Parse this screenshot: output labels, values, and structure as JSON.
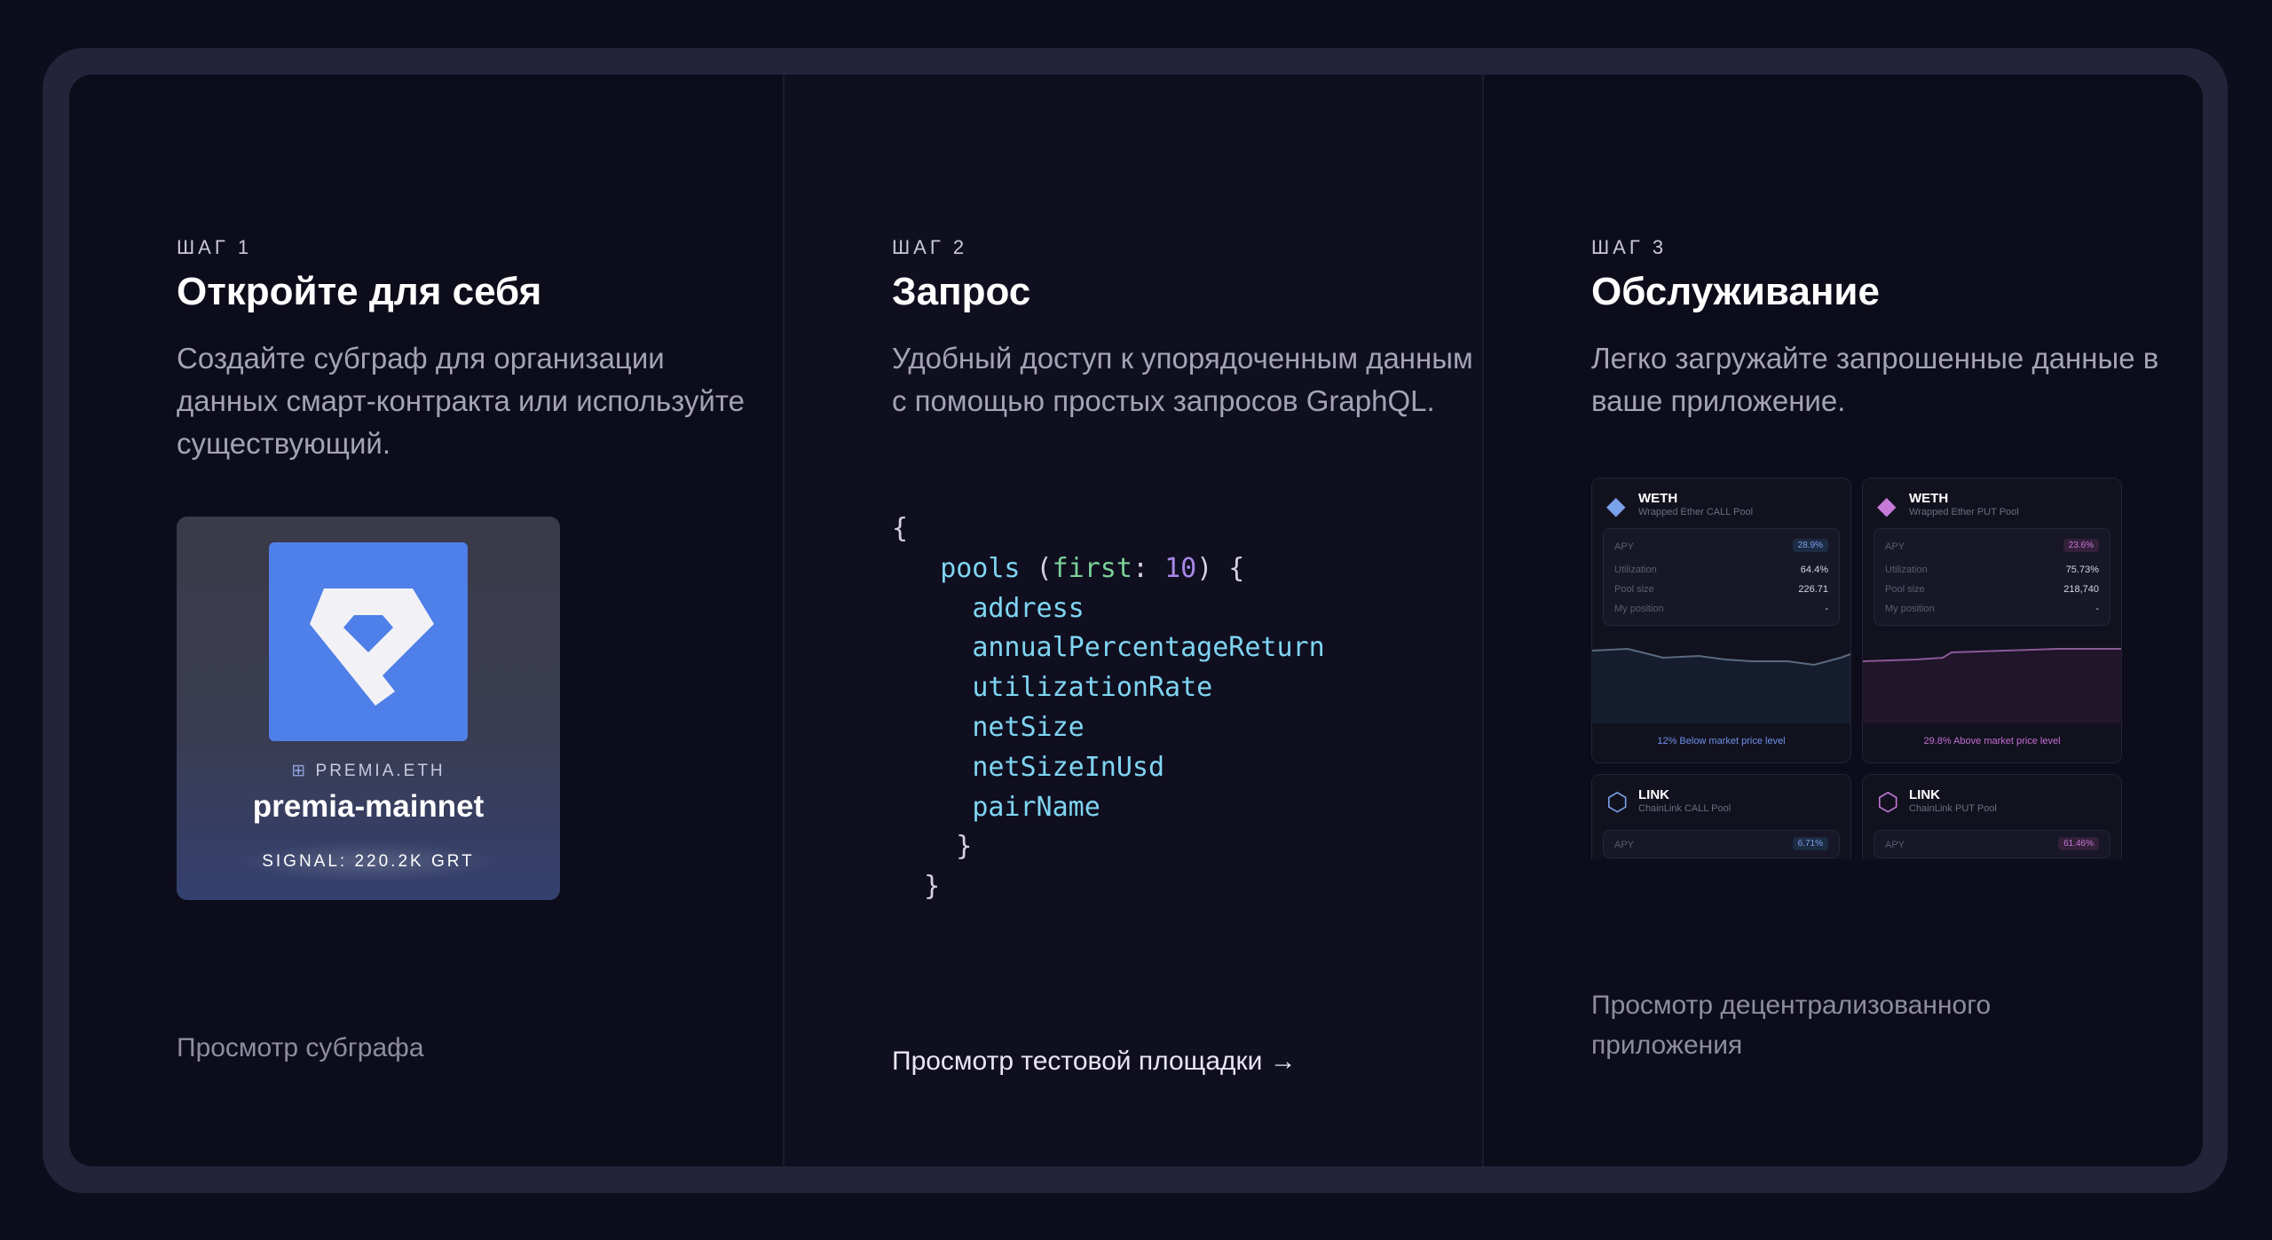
{
  "steps": [
    {
      "step": "ШАГ 1",
      "title": "Откройте для себя",
      "description": "Создайте субграф для организации данных смарт-контракта или используйте существующий.",
      "card": {
        "org": "PREMIA.ETH",
        "name": "premia-mainnet",
        "signal": "SIGNAL: 220.2K GRT"
      },
      "link": "Просмотр субграфа"
    },
    {
      "step": "ШАГ 2",
      "title": "Запрос",
      "description": "Удобный доступ к упорядоченным данным с помощью простых запросов GraphQL.",
      "code": {
        "open_brace": "{",
        "query_name": "pools",
        "arg_name": "first",
        "arg_value": "10",
        "fields": [
          "address",
          "annualPercentageReturn",
          "utilizationRate",
          "netSize",
          "netSizeInUsd",
          "pairName"
        ],
        "inner_close": "}",
        "outer_close": "}"
      },
      "link": "Просмотр тестовой площадки",
      "link_arrow": "→"
    },
    {
      "step": "ШАГ 3",
      "title": "Обслуживание",
      "description": "Легко загружайте запрошенные данные в ваше приложение.",
      "pools": [
        {
          "name": "WETH",
          "sub": "Wrapped Ether CALL Pool",
          "apy_label": "APY",
          "apy": "28.9%",
          "utilization_label": "Utilization",
          "utilization": "64.4%",
          "pool_size_label": "Pool size",
          "pool_size": "226.71",
          "position_label": "My position",
          "position": "-",
          "footer": "12% Below market price level",
          "accent": "#6f8fe6"
        },
        {
          "name": "WETH",
          "sub": "Wrapped Ether PUT Pool",
          "apy_label": "APY",
          "apy": "23.6%",
          "utilization_label": "Utilization",
          "utilization": "75.73%",
          "pool_size_label": "Pool size",
          "pool_size": "218,740",
          "position_label": "My position",
          "position": "-",
          "footer": "29.8% Above market price level",
          "accent": "#c26fd0"
        },
        {
          "name": "LINK",
          "sub": "ChainLink CALL Pool",
          "apy_label": "APY",
          "apy": "6.71%",
          "accent": "#6f8fe6"
        },
        {
          "name": "LINK",
          "sub": "ChainLink PUT Pool",
          "apy_label": "APY",
          "apy": "61.46%",
          "accent": "#c26fd0"
        }
      ],
      "link": "Просмотр децентрализованного приложения"
    }
  ]
}
